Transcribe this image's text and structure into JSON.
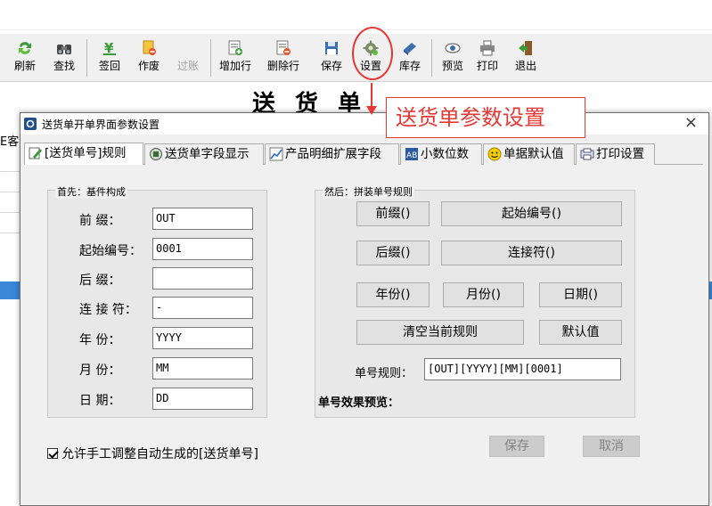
{
  "toolbar": {
    "items": [
      {
        "label": "刷新",
        "icon": "refresh-icon"
      },
      {
        "label": "查找",
        "icon": "binoculars-icon"
      },
      {
        "label": "签回",
        "icon": "yen-icon"
      },
      {
        "label": "作废",
        "icon": "void-icon"
      },
      {
        "label": "过账",
        "icon": "post-icon"
      },
      {
        "label": "增加行",
        "icon": "add-row-icon"
      },
      {
        "label": "删除行",
        "icon": "delete-row-icon"
      },
      {
        "label": "保存",
        "icon": "floppy-icon"
      },
      {
        "label": "设置",
        "icon": "gear-icon"
      },
      {
        "label": "库存",
        "icon": "inventory-icon"
      },
      {
        "label": "预览",
        "icon": "eye-icon"
      },
      {
        "label": "打印",
        "icon": "printer-icon"
      },
      {
        "label": "退出",
        "icon": "exit-icon"
      }
    ]
  },
  "document": {
    "title": "送货单",
    "left_cut_text": "E客"
  },
  "annotation": {
    "text": "送货单参数设置",
    "color": "#e53935"
  },
  "dialog": {
    "title": "送货单开单界面参数设置",
    "close": "×",
    "tabs": [
      {
        "label": "[送货单号]规则",
        "icon": "edit-icon"
      },
      {
        "label": "送货单字段显示",
        "icon": "display-icon"
      },
      {
        "label": "产品明细扩展字段",
        "icon": "chart-icon"
      },
      {
        "label": "小数位数",
        "icon": "decimal-icon"
      },
      {
        "label": "单据默认值",
        "icon": "smiley-icon"
      },
      {
        "label": "打印设置",
        "icon": "print-setup-icon"
      }
    ],
    "left_group": {
      "title": "首先：基件构成",
      "fields": [
        {
          "label": "前    缀：",
          "value": "OUT"
        },
        {
          "label": "起始编号：",
          "value": "0001"
        },
        {
          "label": "后    缀：",
          "value": ""
        },
        {
          "label": "连 接 符：",
          "value": "-"
        },
        {
          "label": "年    份：",
          "value": "YYYY"
        },
        {
          "label": "月    份：",
          "value": "MM"
        },
        {
          "label": "日    期：",
          "value": "DD"
        }
      ]
    },
    "right_group": {
      "title": "然后：拼装单号规则",
      "buttons": {
        "prefix": "前缀()",
        "start_no": "起始编号()",
        "suffix": "后缀()",
        "connector": "连接符()",
        "year": "年份()",
        "month": "月份()",
        "day": "日期()",
        "clear": "清空当前规则",
        "default": "默认值"
      },
      "rule_label": "单号规则：",
      "rule_value": "[OUT][YYYY][MM][0001]",
      "preview_label": "单号效果预览："
    },
    "checkbox_label": "允许手工调整自动生成的[送货单号]",
    "save": "保存",
    "cancel": "取消"
  }
}
